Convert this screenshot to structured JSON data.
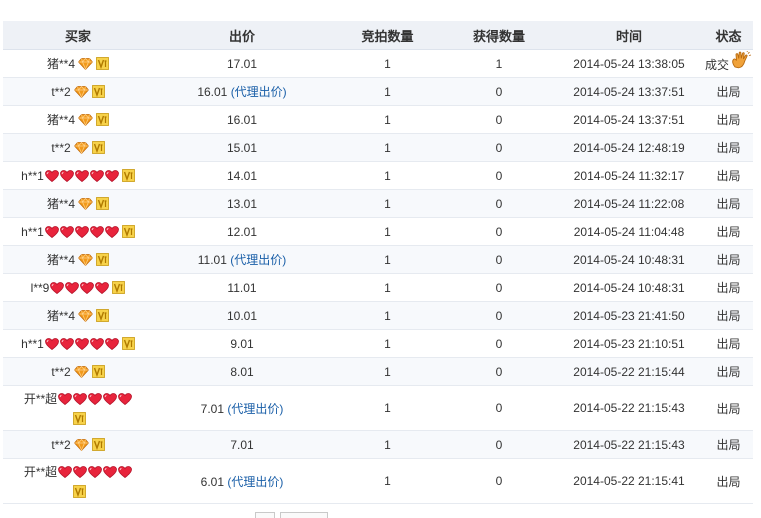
{
  "table": {
    "headers": {
      "buyer": "买家",
      "price": "出价",
      "bid_qty": "竞拍数量",
      "win_qty": "获得数量",
      "time": "时间",
      "status": "状态"
    },
    "rows": [
      {
        "buyer": "猪**4",
        "badge": "diamond",
        "hearts": 0,
        "price": "17.01",
        "proxy": "",
        "bid_qty": "1",
        "win_qty": "1",
        "time": "2014-05-24 13:38:05",
        "status": "成交",
        "deal": true
      },
      {
        "buyer": "t**2",
        "badge": "diamond",
        "hearts": 0,
        "price": "16.01",
        "proxy": "(代理出价)",
        "bid_qty": "1",
        "win_qty": "0",
        "time": "2014-05-24 13:37:51",
        "status": "出局",
        "deal": false
      },
      {
        "buyer": "猪**4",
        "badge": "diamond",
        "hearts": 0,
        "price": "16.01",
        "proxy": "",
        "bid_qty": "1",
        "win_qty": "0",
        "time": "2014-05-24 13:37:51",
        "status": "出局",
        "deal": false
      },
      {
        "buyer": "t**2",
        "badge": "diamond",
        "hearts": 0,
        "price": "15.01",
        "proxy": "",
        "bid_qty": "1",
        "win_qty": "0",
        "time": "2014-05-24 12:48:19",
        "status": "出局",
        "deal": false
      },
      {
        "buyer": "h**1",
        "badge": "hearts",
        "hearts": 5,
        "price": "14.01",
        "proxy": "",
        "bid_qty": "1",
        "win_qty": "0",
        "time": "2014-05-24 11:32:17",
        "status": "出局",
        "deal": false
      },
      {
        "buyer": "猪**4",
        "badge": "diamond",
        "hearts": 0,
        "price": "13.01",
        "proxy": "",
        "bid_qty": "1",
        "win_qty": "0",
        "time": "2014-05-24 11:22:08",
        "status": "出局",
        "deal": false
      },
      {
        "buyer": "h**1",
        "badge": "hearts",
        "hearts": 5,
        "price": "12.01",
        "proxy": "",
        "bid_qty": "1",
        "win_qty": "0",
        "time": "2014-05-24 11:04:48",
        "status": "出局",
        "deal": false
      },
      {
        "buyer": "猪**4",
        "badge": "diamond",
        "hearts": 0,
        "price": "11.01",
        "proxy": "(代理出价)",
        "bid_qty": "1",
        "win_qty": "0",
        "time": "2014-05-24 10:48:31",
        "status": "出局",
        "deal": false
      },
      {
        "buyer": "l**9",
        "badge": "hearts",
        "hearts": 4,
        "price": "11.01",
        "proxy": "",
        "bid_qty": "1",
        "win_qty": "0",
        "time": "2014-05-24 10:48:31",
        "status": "出局",
        "deal": false
      },
      {
        "buyer": "猪**4",
        "badge": "diamond",
        "hearts": 0,
        "price": "10.01",
        "proxy": "",
        "bid_qty": "1",
        "win_qty": "0",
        "time": "2014-05-23 21:41:50",
        "status": "出局",
        "deal": false
      },
      {
        "buyer": "h**1",
        "badge": "hearts",
        "hearts": 5,
        "price": "9.01",
        "proxy": "",
        "bid_qty": "1",
        "win_qty": "0",
        "time": "2014-05-23 21:10:51",
        "status": "出局",
        "deal": false
      },
      {
        "buyer": "t**2",
        "badge": "diamond",
        "hearts": 0,
        "price": "8.01",
        "proxy": "",
        "bid_qty": "1",
        "win_qty": "0",
        "time": "2014-05-22 21:15:44",
        "status": "出局",
        "deal": false
      },
      {
        "buyer": "开**超",
        "badge": "hearts",
        "hearts": 5,
        "wrap": true,
        "price": "7.01",
        "proxy": "(代理出价)",
        "bid_qty": "1",
        "win_qty": "0",
        "time": "2014-05-22 21:15:43",
        "status": "出局",
        "deal": false
      },
      {
        "buyer": "t**2",
        "badge": "diamond",
        "hearts": 0,
        "price": "7.01",
        "proxy": "",
        "bid_qty": "1",
        "win_qty": "0",
        "time": "2014-05-22 21:15:43",
        "status": "出局",
        "deal": false
      },
      {
        "buyer": "开**超",
        "badge": "hearts",
        "hearts": 5,
        "wrap": true,
        "price": "6.01",
        "proxy": "(代理出价)",
        "bid_qty": "1",
        "win_qty": "0",
        "time": "2014-05-22 21:15:41",
        "status": "出局",
        "deal": false
      }
    ]
  },
  "icons": {
    "heart": "red-heart-rank-icon",
    "diamond": "orange-diamond-rank-icon",
    "vip": "vip-badge-icon",
    "deal": "waving-hand-icon"
  },
  "colors": {
    "header_bg": "#eef1f6",
    "alt_row_bg": "#f7f9fc",
    "proxy_link": "#1a5fa8",
    "heart_red": "#e8243c",
    "diamond_orange": "#f29a1c",
    "vip_yellow": "#f2c230",
    "hand_orange": "#f0a23a"
  }
}
